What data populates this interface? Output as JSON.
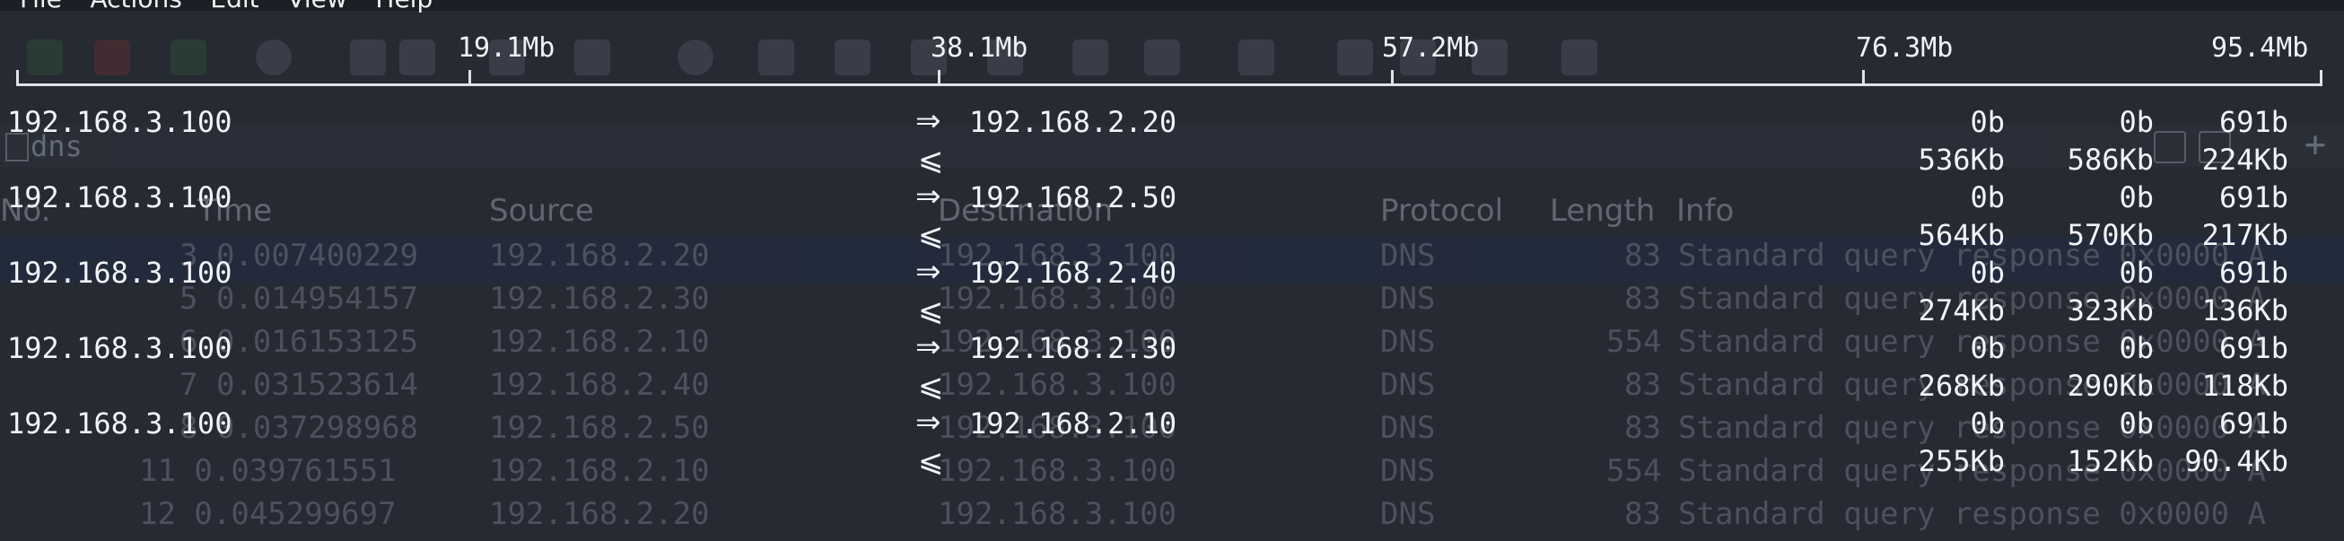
{
  "menubar": {
    "items": [
      "File",
      "Actions",
      "Edit",
      "View",
      "Help"
    ]
  },
  "filter": {
    "value": "dns"
  },
  "packet_list": {
    "columns": [
      "No.",
      "Time",
      "Source",
      "Destination",
      "Protocol",
      "Length",
      "Info"
    ],
    "rows": [
      {
        "no_time": "3 0.007400229",
        "src": "192.168.2.20",
        "dst": "192.168.3.100",
        "proto": "DNS",
        "len": "83",
        "info": "Standard query response 0x0000 A"
      },
      {
        "no_time": "5 0.014954157",
        "src": "192.168.2.30",
        "dst": "192.168.3.100",
        "proto": "DNS",
        "len": "83",
        "info": "Standard query response 0x0000 A"
      },
      {
        "no_time": "6 0.016153125",
        "src": "192.168.2.10",
        "dst": "192.168.3.100",
        "proto": "DNS",
        "len": "554",
        "info": "Standard query response 0x0000 A"
      },
      {
        "no_time": "7 0.031523614",
        "src": "192.168.2.40",
        "dst": "192.168.3.100",
        "proto": "DNS",
        "len": "83",
        "info": "Standard query response 0x0000 A"
      },
      {
        "no_time": "8 0.037298968",
        "src": "192.168.2.50",
        "dst": "192.168.3.100",
        "proto": "DNS",
        "len": "83",
        "info": "Standard query response 0x0000 A"
      },
      {
        "no_time": "11 0.039761551",
        "src": "192.168.2.10",
        "dst": "192.168.3.100",
        "proto": "DNS",
        "len": "554",
        "info": "Standard query response 0x0000 A"
      },
      {
        "no_time": "12 0.045299697",
        "src": "192.168.2.20",
        "dst": "192.168.3.100",
        "proto": "DNS",
        "len": "83",
        "info": "Standard query response 0x0000 A"
      }
    ]
  },
  "iftop": {
    "scale": [
      "19.1Mb",
      "38.1Mb",
      "57.2Mb",
      "76.3Mb",
      "95.4Mb"
    ],
    "send_arrow": "⇒",
    "recv_arrow": "⩽",
    "flows": [
      {
        "src": "192.168.3.100",
        "dst": "192.168.2.20",
        "tx": [
          "0b",
          "0b",
          "691b"
        ],
        "rx": [
          "536Kb",
          "586Kb",
          "224Kb"
        ]
      },
      {
        "src": "192.168.3.100",
        "dst": "192.168.2.50",
        "tx": [
          "0b",
          "0b",
          "691b"
        ],
        "rx": [
          "564Kb",
          "570Kb",
          "217Kb"
        ]
      },
      {
        "src": "192.168.3.100",
        "dst": "192.168.2.40",
        "tx": [
          "0b",
          "0b",
          "691b"
        ],
        "rx": [
          "274Kb",
          "323Kb",
          "136Kb"
        ]
      },
      {
        "src": "192.168.3.100",
        "dst": "192.168.2.30",
        "tx": [
          "0b",
          "0b",
          "691b"
        ],
        "rx": [
          "268Kb",
          "290Kb",
          "118Kb"
        ]
      },
      {
        "src": "192.168.3.100",
        "dst": "192.168.2.10",
        "tx": [
          "0b",
          "0b",
          "691b"
        ],
        "rx": [
          "255Kb",
          "152Kb",
          "90.4Kb"
        ]
      }
    ]
  }
}
